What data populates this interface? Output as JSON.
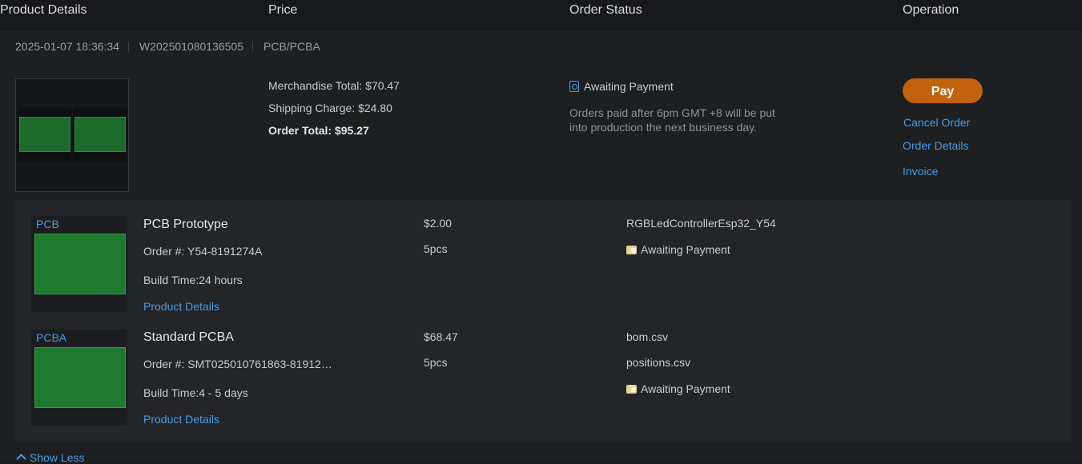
{
  "columns": {
    "product_details": "Product Details",
    "price": "Price",
    "order_status": "Order Status",
    "operation": "Operation"
  },
  "order": {
    "date": "2025-01-07 18:36:34",
    "order_no": "W202501080136505",
    "type": "PCB/PCBA",
    "merchandise_total": "Merchandise Total: $70.47",
    "shipping_charge": "Shipping Charge: $24.80",
    "order_total": "Order Total: $95.27",
    "status": "Awaiting Payment",
    "status_note": "Orders paid after 6pm GMT +8 will be put into production the next business day.",
    "status_icon": "document-search-icon",
    "status_icon_color": "#4a9be0"
  },
  "operations": {
    "pay": "Pay",
    "pay_color": "#c2610e",
    "cancel_order": "Cancel Order",
    "order_details": "Order Details",
    "invoice": "Invoice"
  },
  "items": [
    {
      "tag": "PCB",
      "title": "PCB Prototype",
      "order_no": "Order #: Y54-8191274A",
      "build_time": "Build Time:24 hours",
      "details_link": "Product Details",
      "price": "$2.00",
      "qty": "5pcs",
      "file": "RGBLedControllerEsp32_Y54",
      "status": "Awaiting Payment"
    },
    {
      "tag": "PCBA",
      "title": "Standard PCBA",
      "order_no": "Order #: SMT025010761863-81912…",
      "build_time": "Build Time:4 - 5 days",
      "details_link": "Product Details",
      "price": "$68.47",
      "qty": "5pcs",
      "file1": "bom.csv",
      "file2": "positions.csv",
      "status": "Awaiting Payment"
    }
  ],
  "show_less": "Show Less",
  "colors": {
    "link": "#4a9be0",
    "background": "#1b1c1e",
    "panel": "#232528"
  }
}
